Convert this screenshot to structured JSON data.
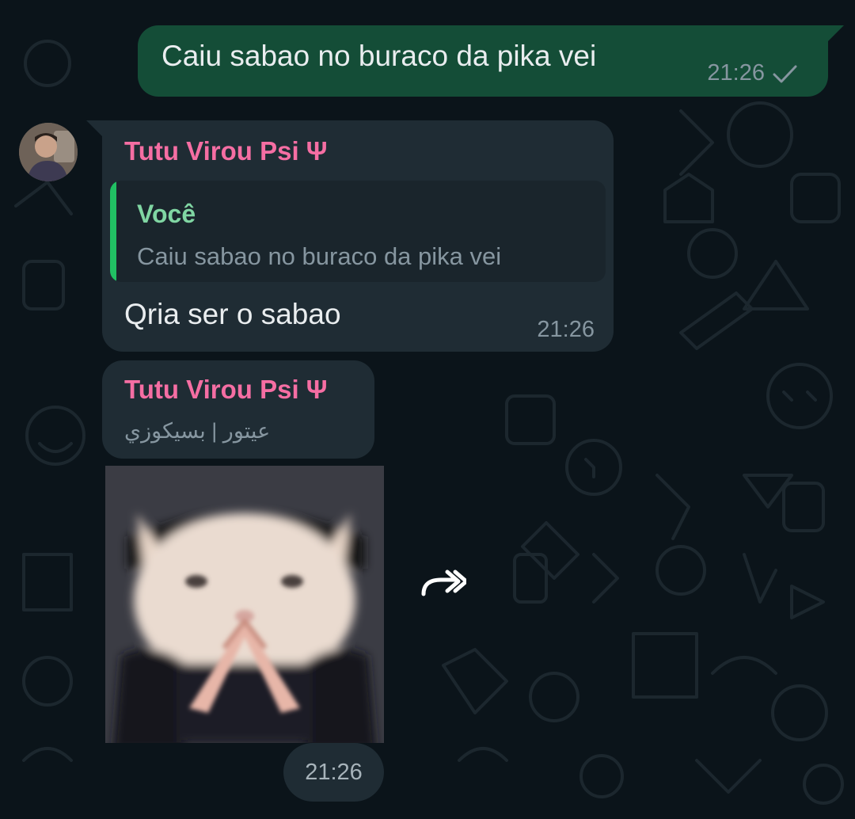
{
  "outgoing_message": {
    "text": "Caiu sabao no buraco da pika vei",
    "time": "21:26",
    "status_icon": "single-check-icon"
  },
  "reply_message": {
    "sender": "Tutu Virou Psi Ψ",
    "quote_author": "Você",
    "quote_text": "Caiu sabao no buraco da pika vei",
    "text": "Qria ser o sabao",
    "time": "21:26"
  },
  "sticker_message": {
    "sender": "Tutu Virou Psi Ψ",
    "subtitle": "عيتور | بسيكوزي",
    "sticker_icon": "cat-sticker-image",
    "time": "21:26"
  },
  "forward_button": {
    "icon": "forward-icon"
  },
  "colors": {
    "background": "#0b141a",
    "outgoing_bubble": "#144d37",
    "incoming_bubble": "#1f2c34",
    "sender_name": "#f56ea3",
    "quote_bar": "#21c063",
    "quote_author": "#80d6a3",
    "text_primary": "#e9edef",
    "text_secondary": "#8696a0"
  }
}
